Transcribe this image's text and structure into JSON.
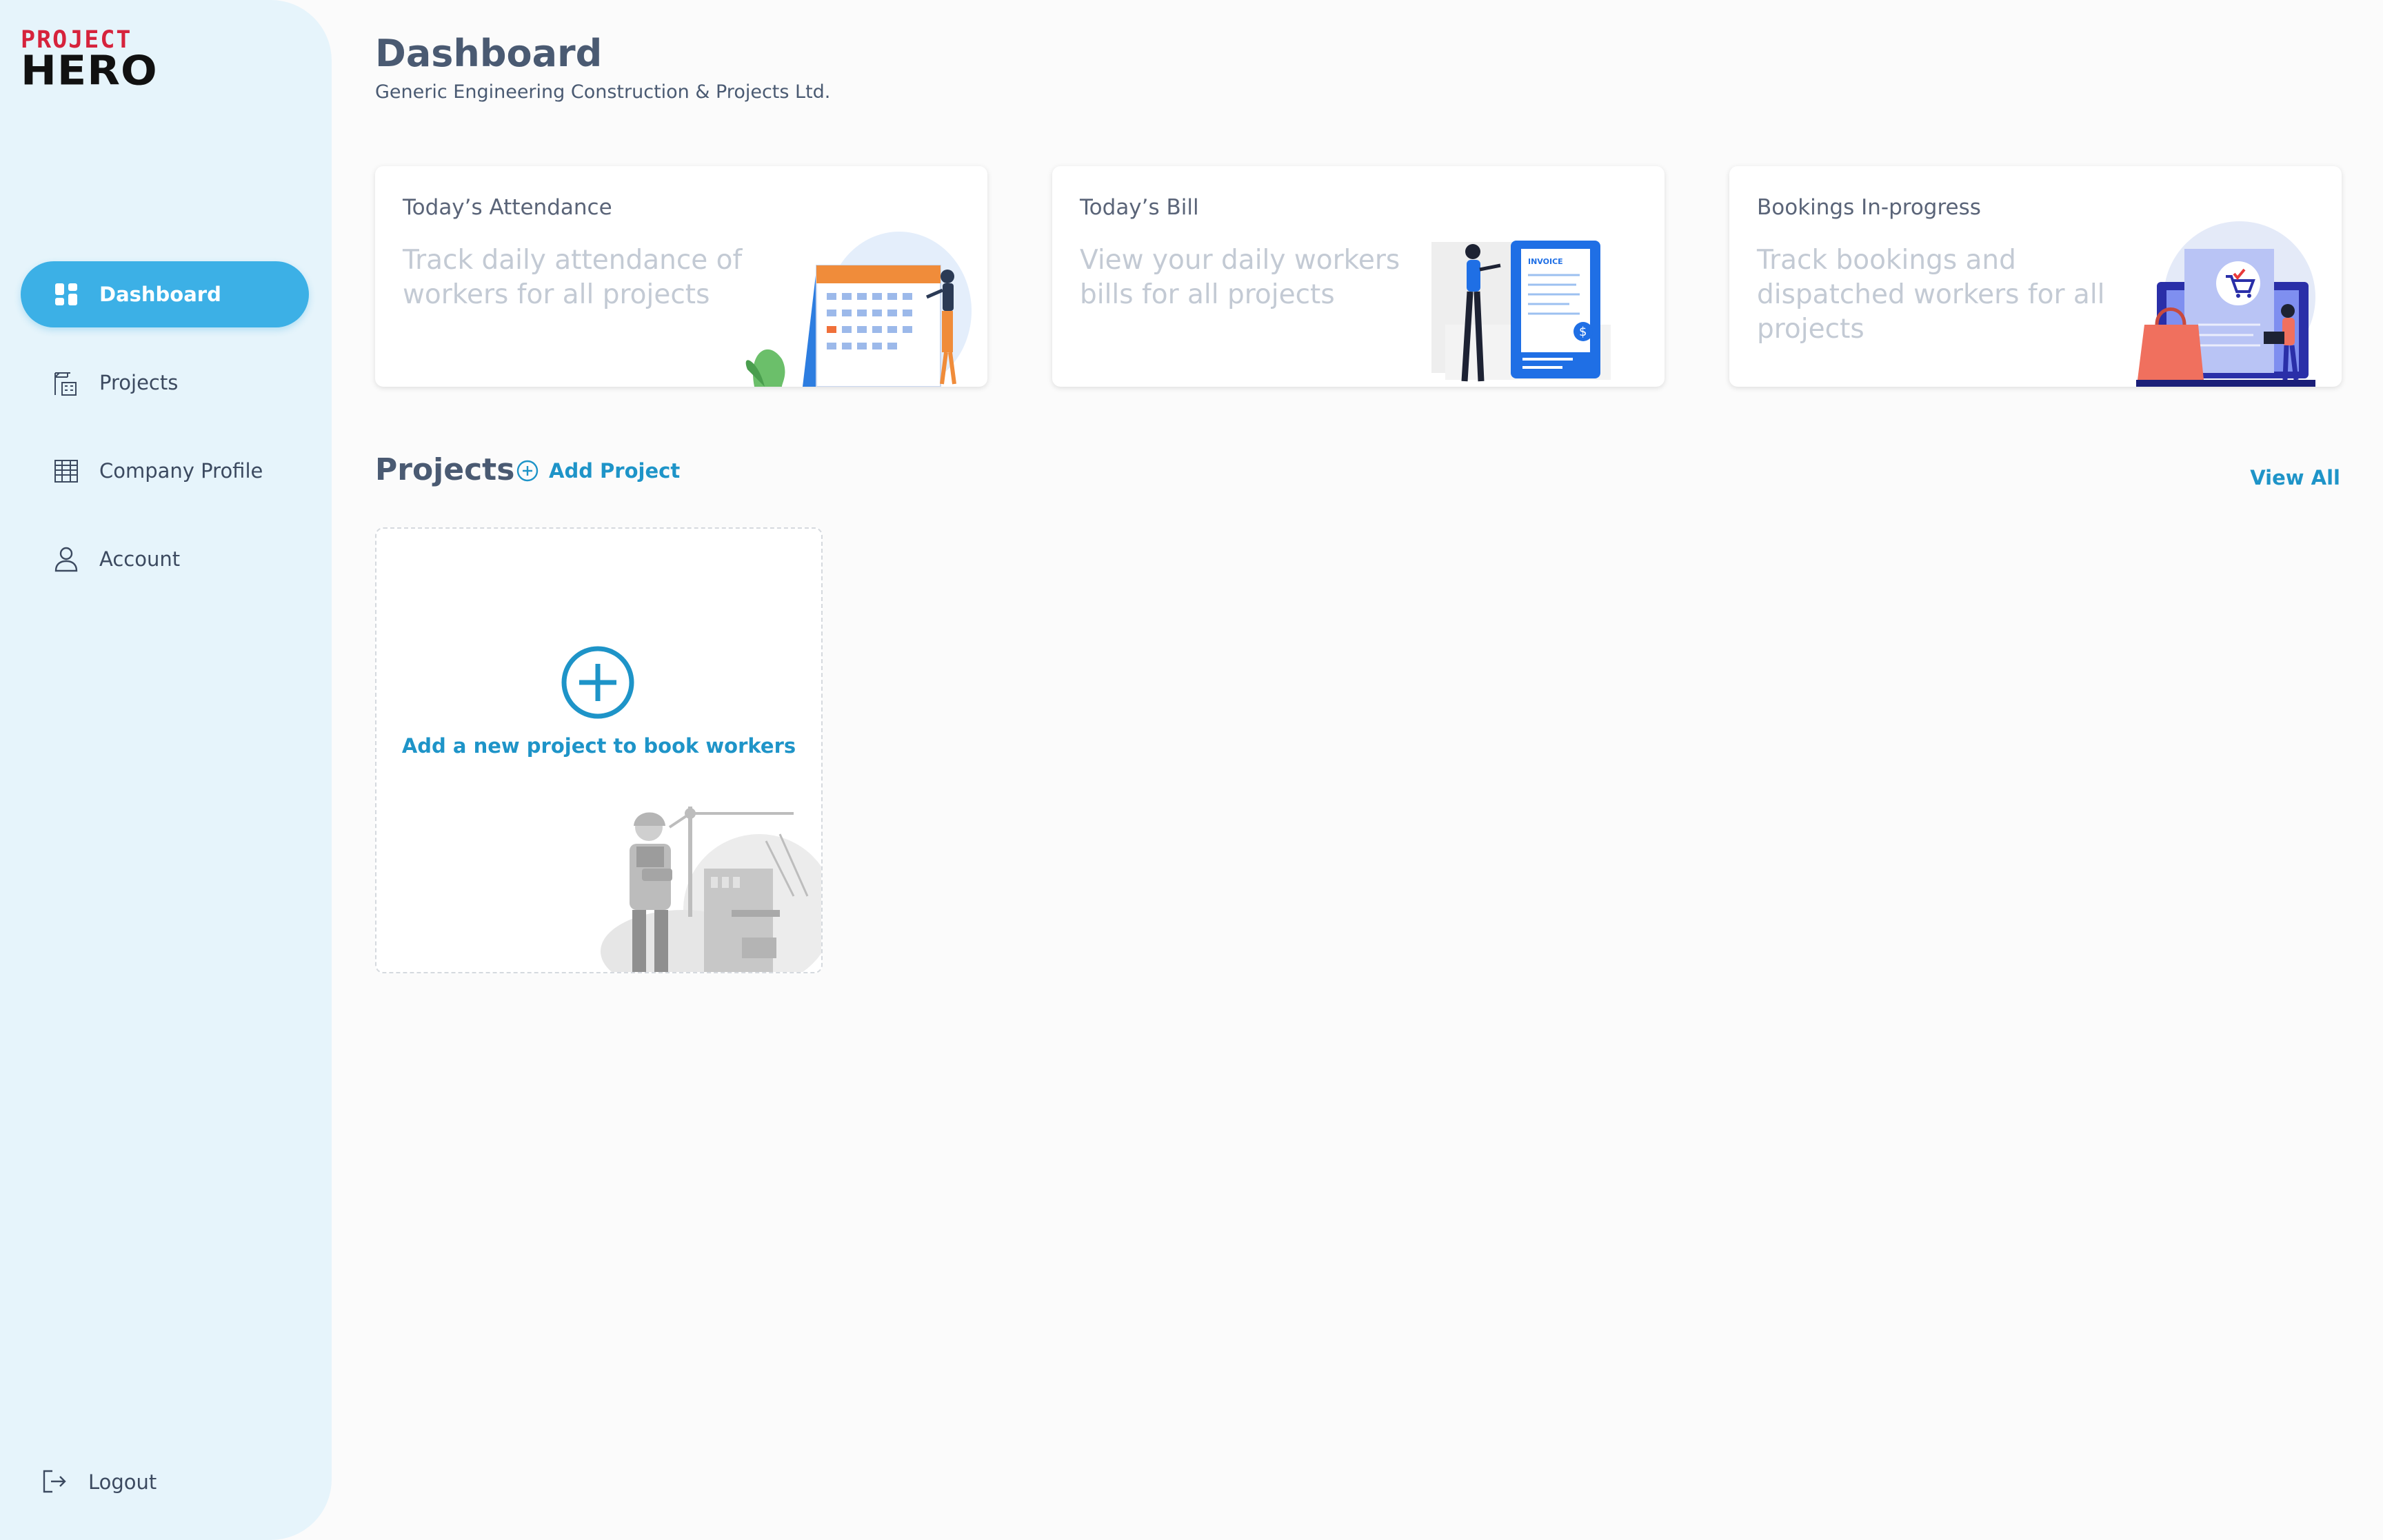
{
  "brand": {
    "line1": "PROJECT",
    "line2": "HERO"
  },
  "sidebar": {
    "items": [
      {
        "label": "Dashboard",
        "icon": "dashboard-grid-icon",
        "active": true
      },
      {
        "label": "Projects",
        "icon": "crane-building-icon",
        "active": false
      },
      {
        "label": "Company Profile",
        "icon": "office-building-icon",
        "active": false
      },
      {
        "label": "Account",
        "icon": "user-icon",
        "active": false
      }
    ],
    "logout_label": "Logout"
  },
  "header": {
    "title": "Dashboard",
    "subtitle": "Generic Engineering Construction & Projects Ltd."
  },
  "cards": [
    {
      "title": "Today’s Attendance",
      "description": "Track daily attendance of workers for all projects",
      "illustration": "calendar-illustration"
    },
    {
      "title": "Today’s Bill",
      "description": "View your daily workers bills for all projects",
      "illustration": "invoice-illustration"
    },
    {
      "title": "Bookings In-progress",
      "description": "Track bookings and dispatched workers for all projects",
      "illustration": "shopping-laptop-illustration"
    }
  ],
  "projects": {
    "title": "Projects",
    "add_label": "Add Project",
    "view_all_label": "View All",
    "empty_card_label": "Add a new project to book workers"
  },
  "colors": {
    "sidebar_bg": "#e6f4fb",
    "accent": "#3cb0e6",
    "link": "#1e94c8",
    "brand_red": "#d6233c"
  }
}
